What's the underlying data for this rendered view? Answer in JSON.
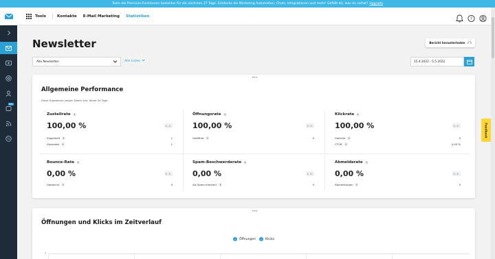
{
  "banner": {
    "text": "Teste die Premium-Funktionen kostenlos für die nächsten 27 Tage. Entdecke die Marketing Automation, Chats, Integrationen und mehr! Gefällt dir, was du siehst?",
    "link": "Upgrade"
  },
  "topbar": {
    "tools_label": "Tools",
    "nav": [
      "Kontakte",
      "E-Mail Marketing",
      "Statistiken"
    ],
    "active_nav": "Statistiken"
  },
  "sidebar": {
    "badge": "NEU",
    "items": [
      "expand-icon",
      "mail-icon",
      "automation-icon",
      "target-icon",
      "contacts-icon",
      "chat-icon",
      "rss-icon",
      "settings-icon"
    ]
  },
  "colors": {
    "accent": "#2aa0d6",
    "sidebar": "#1e2c3a",
    "banner": "#3fb8e5",
    "feedback": "#ffd633"
  },
  "page": {
    "title": "Newsletter",
    "report_button": "Bericht herunterladen",
    "newsletter_select": "Alle Newsletter",
    "lists_filter": "Alle Listen",
    "date_range": "15.4.2022 - 5.5.2022"
  },
  "performance": {
    "title": "Allgemeine Performance",
    "subtitle": "Diese Ergebnisse zeigen Daten von: letzte 30 Tage.",
    "metrics": [
      {
        "name": "Zustellrate",
        "value": "100,00 %",
        "badge": "k. A.",
        "rows": [
          {
            "label": "Zugestellt",
            "value": "1"
          },
          {
            "label": "Gesendet",
            "value": "1"
          }
        ]
      },
      {
        "name": "Öffnungsrate",
        "value": "100,00 %",
        "badge": "k. A.",
        "rows": [
          {
            "label": "Geöffnet",
            "value": "0"
          }
        ]
      },
      {
        "name": "Klickrate",
        "value": "100,00 %",
        "badge": "k. A.",
        "rows": [
          {
            "label": "Geklickt",
            "value": "0"
          },
          {
            "label": "CTOR",
            "value": "0,00 %"
          }
        ]
      },
      {
        "name": "Bounce-Rate",
        "value": "0,00 %",
        "badge": "k. A.",
        "rows": [
          {
            "label": "Gebounct",
            "value": "0"
          }
        ]
      },
      {
        "name": "Spam-Beschwerderate",
        "value": "0,00 %",
        "badge": "k. A.",
        "rows": [
          {
            "label": "Als Spam markiert",
            "value": "0"
          }
        ]
      },
      {
        "name": "Abmelderate",
        "value": "0,00 %",
        "badge": "k. A.",
        "rows": [
          {
            "label": "Abmeldungen",
            "value": "0"
          }
        ]
      }
    ]
  },
  "timeline": {
    "title": "Öffnungen und Klicks im Zeitverlauf",
    "legend": [
      "Öffnungen",
      "Klicks"
    ],
    "ytick": "4"
  },
  "feedback_tab": "Feedback"
}
